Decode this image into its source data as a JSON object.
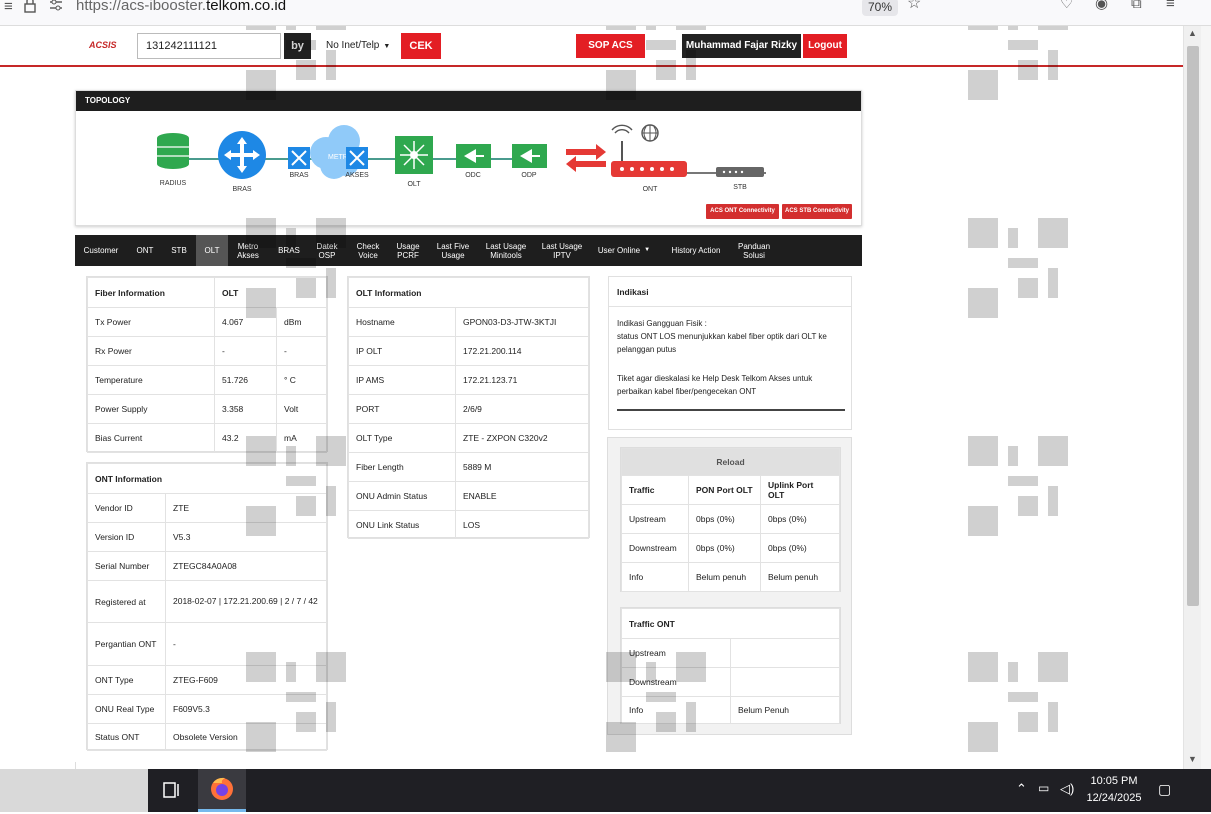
{
  "browser": {
    "url_prefix": "https://acs-ibooster.",
    "url_domain": "telkom.co.id",
    "zoom": "70%"
  },
  "nav": {
    "logo": "ACSIS",
    "search_value": "131242111121",
    "by_label": "by",
    "select_value": "No Inet/Telp",
    "cek_label": "CEK",
    "sop_label": "SOP ACS",
    "user_name": "Muhammad Fajar Rizky",
    "logout_label": "Logout"
  },
  "topology": {
    "title": "TOPOLOGY",
    "nodes": [
      "RADIUS",
      "BRAS",
      "BRAS",
      "METRO - E",
      "AKSES",
      "OLT",
      "ODC",
      "ODP",
      "ONT",
      "STB"
    ],
    "btn_ont": "ACS ONT Connectivity",
    "btn_stb": "ACS STB Connectivity"
  },
  "tabs": [
    {
      "l1": "Customer",
      "l2": ""
    },
    {
      "l1": "ONT",
      "l2": ""
    },
    {
      "l1": "STB",
      "l2": ""
    },
    {
      "l1": "OLT",
      "l2": ""
    },
    {
      "l1": "Metro",
      "l2": "Akses"
    },
    {
      "l1": "BRAS",
      "l2": ""
    },
    {
      "l1": "Datek",
      "l2": "OSP"
    },
    {
      "l1": "Check",
      "l2": "Voice"
    },
    {
      "l1": "Usage",
      "l2": "PCRF"
    },
    {
      "l1": "Last Five",
      "l2": "Usage"
    },
    {
      "l1": "Last Usage",
      "l2": "Minitools"
    },
    {
      "l1": "Last Usage",
      "l2": "IPTV"
    },
    {
      "l1": "User Online",
      "l2": ""
    },
    {
      "l1": "History Action",
      "l2": ""
    },
    {
      "l1": "Panduan",
      "l2": "Solusi"
    }
  ],
  "fiber": {
    "title": "Fiber Information",
    "col": "OLT",
    "rows": [
      {
        "k": "Tx Power",
        "v": "4.067",
        "u": "dBm"
      },
      {
        "k": "Rx Power",
        "v": "-",
        "u": "-"
      },
      {
        "k": "Temperature",
        "v": "51.726",
        "u": "° C"
      },
      {
        "k": "Power Supply",
        "v": "3.358",
        "u": "Volt"
      },
      {
        "k": "Bias Current",
        "v": "43.2",
        "u": "mA"
      }
    ]
  },
  "ont": {
    "title": "ONT Information",
    "rows": [
      {
        "k": "Vendor ID",
        "v": "ZTE"
      },
      {
        "k": "Version ID",
        "v": "V5.3"
      },
      {
        "k": "Serial Number",
        "v": "ZTEGC84A0A08"
      },
      {
        "k": "Registered at",
        "v": "2018-02-07 | 172.21.200.69 | 2 / 7 / 42"
      },
      {
        "k": "Pergantian ONT",
        "v": "-"
      },
      {
        "k": "ONT Type",
        "v": "ZTEG-F609"
      },
      {
        "k": "ONU Real Type",
        "v": "F609V5.3"
      },
      {
        "k": "Status ONT",
        "v": "Obsolete Version"
      }
    ]
  },
  "olt": {
    "title": "OLT Information",
    "rows": [
      {
        "k": "Hostname",
        "v": "GPON03-D3-JTW-3KTJI"
      },
      {
        "k": "IP OLT",
        "v": "172.21.200.114"
      },
      {
        "k": "IP AMS",
        "v": "172.21.123.71"
      },
      {
        "k": "PORT",
        "v": "2/6/9"
      },
      {
        "k": "OLT Type",
        "v": "ZTE - ZXPON C320v2"
      },
      {
        "k": "Fiber Length",
        "v": "5889 M"
      },
      {
        "k": "ONU Admin Status",
        "v": "ENABLE"
      },
      {
        "k": "ONU Link Status",
        "v": "LOS"
      }
    ]
  },
  "indikasi": {
    "title": "Indikasi",
    "line1": "Indikasi Gangguan Fisik :",
    "line2": "status ONT LOS menunjukkan kabel fiber optik dari OLT ke pelanggan putus",
    "line3": "Tiket agar dieskalasi ke Help Desk Telkom Akses untuk perbaikan kabel fiber/pengecekan ONT"
  },
  "reload": {
    "title": "Reload",
    "headers": [
      "Traffic",
      "PON Port OLT",
      "Uplink Port OLT"
    ],
    "rows": [
      [
        "Upstream",
        "0bps (0%)",
        "0bps (0%)"
      ],
      [
        "Downstream",
        "0bps (0%)",
        "0bps (0%)"
      ],
      [
        "Info",
        "Belum penuh",
        "Belum penuh"
      ]
    ]
  },
  "traffic_ont": {
    "title": "Traffic ONT",
    "rows": [
      [
        "Upstream",
        ""
      ],
      [
        "Downstream",
        ""
      ],
      [
        "Info",
        "Belum Penuh"
      ]
    ]
  },
  "taskbar": {
    "time": "10:05 PM",
    "date": "12/24/2025"
  }
}
